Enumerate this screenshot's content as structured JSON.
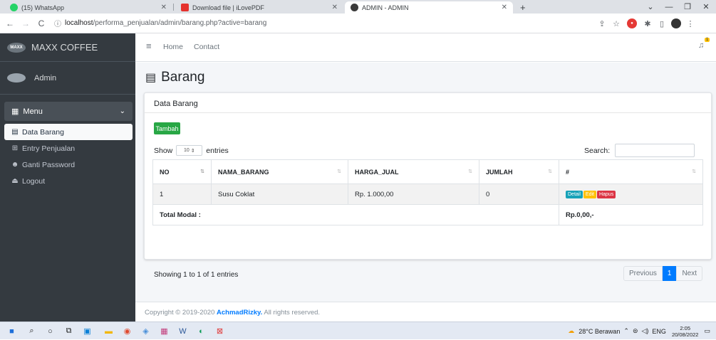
{
  "browser": {
    "tabs": [
      {
        "title": "(15) WhatsApp",
        "active": false
      },
      {
        "title": "Download file | iLovePDF",
        "active": false
      },
      {
        "title": "ADMIN - ADMIN",
        "active": true
      }
    ],
    "new_tab": "+",
    "url_host": "localhost",
    "url_path": "/performa_penjualan/admin/barang.php?active=barang"
  },
  "sidebar": {
    "brand": "MAXX COFFEE",
    "brand_logo": "MAXX",
    "user": "Admin",
    "menu_label": "Menu",
    "items": [
      {
        "label": "Data Barang",
        "icon": "box-icon",
        "active": true
      },
      {
        "label": "Entry Penjualan",
        "icon": "cart-icon",
        "active": false
      },
      {
        "label": "Ganti Password",
        "icon": "users-icon",
        "active": false
      },
      {
        "label": "Logout",
        "icon": "logout-icon",
        "active": false
      }
    ]
  },
  "topnav": {
    "home": "Home",
    "contact": "Contact",
    "notification_count": "1"
  },
  "page": {
    "title": "Barang"
  },
  "card": {
    "header": "Data Barang",
    "add_button": "Tambah",
    "show_label": "Show",
    "entries_value": "10",
    "entries_label": "entries",
    "search_label": "Search:",
    "columns": [
      "NO",
      "NAMA_BARANG",
      "HARGA_JUAL",
      "JUMLAH",
      "#"
    ],
    "rows": [
      {
        "no": "1",
        "nama": "Susu Coklat",
        "harga": "Rp. 1.000,00",
        "jumlah": "0"
      }
    ],
    "row_actions": {
      "detail": "Detail",
      "edit": "Edit",
      "hapus": "Hapus"
    },
    "total_label": "Total Modal :",
    "total_value": "Rp.0,00,-",
    "info": "Showing 1 to 1 of 1 entries",
    "pager": {
      "previous": "Previous",
      "current": "1",
      "next": "Next"
    }
  },
  "footer": {
    "prefix": "Copyright © 2019-2020 ",
    "author": "AchmadRizky.",
    "suffix": " All rights reserved."
  },
  "taskbar": {
    "weather": "28°C Berawan",
    "lang": "ENG",
    "time": "2:05",
    "date": "20/08/2022"
  },
  "colors": {
    "sidebar_bg": "#343a40",
    "primary": "#007bff",
    "success": "#28a745",
    "info": "#17a2b8",
    "warning": "#ffc107",
    "danger": "#dc3545"
  }
}
